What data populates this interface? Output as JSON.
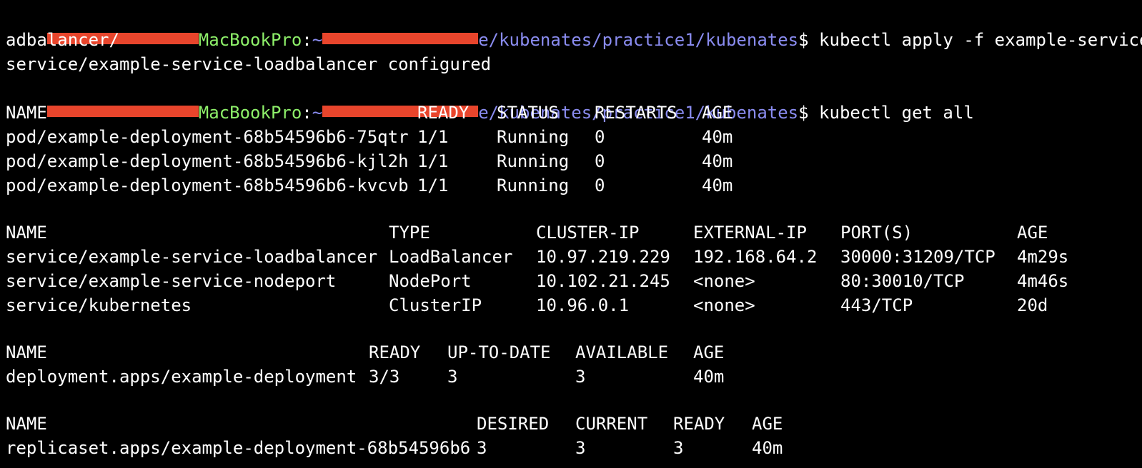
{
  "terminal": {
    "colors": {
      "background": "#000000",
      "text": "#ffffff",
      "host": "#8ef06a",
      "path": "#8a8cf0",
      "redaction": "#e8452c"
    },
    "prompt": {
      "host": "MacBookPro",
      "colon": ":",
      "path_visible": "e/kubenates/practice1/kubenates",
      "dollar": "$"
    },
    "commands": {
      "apply": " kubectl apply -f example-service-lo",
      "apply_wrap": "adbalancer/",
      "apply_output": "service/example-service-loadbalancer configured",
      "get_all": " kubectl get all"
    },
    "pods": {
      "headers": [
        "NAME",
        "READY",
        "STATUS",
        "RESTARTS",
        "AGE"
      ],
      "rows": [
        [
          "pod/example-deployment-68b54596b6-75qtr",
          "1/1",
          "Running",
          "0",
          "40m"
        ],
        [
          "pod/example-deployment-68b54596b6-kjl2h",
          "1/1",
          "Running",
          "0",
          "40m"
        ],
        [
          "pod/example-deployment-68b54596b6-kvcvb",
          "1/1",
          "Running",
          "0",
          "40m"
        ]
      ]
    },
    "services": {
      "headers": [
        "NAME",
        "TYPE",
        "CLUSTER-IP",
        "EXTERNAL-IP",
        "PORT(S)",
        "AGE"
      ],
      "rows": [
        [
          "service/example-service-loadbalancer",
          "LoadBalancer",
          "10.97.219.229",
          "192.168.64.2",
          "30000:31209/TCP",
          "4m29s"
        ],
        [
          "service/example-service-nodeport",
          "NodePort",
          "10.102.21.245",
          "<none>",
          "80:30010/TCP",
          "4m46s"
        ],
        [
          "service/kubernetes",
          "ClusterIP",
          "10.96.0.1",
          "<none>",
          "443/TCP",
          "20d"
        ]
      ]
    },
    "deployments": {
      "headers": [
        "NAME",
        "READY",
        "UP-TO-DATE",
        "AVAILABLE",
        "AGE"
      ],
      "rows": [
        [
          "deployment.apps/example-deployment",
          "3/3",
          "3",
          "3",
          "40m"
        ]
      ]
    },
    "replicasets": {
      "headers": [
        "NAME",
        "DESIRED",
        "CURRENT",
        "READY",
        "AGE"
      ],
      "rows": [
        [
          "replicaset.apps/example-deployment-68b54596b6",
          "3",
          "3",
          "3",
          "40m"
        ]
      ]
    }
  }
}
